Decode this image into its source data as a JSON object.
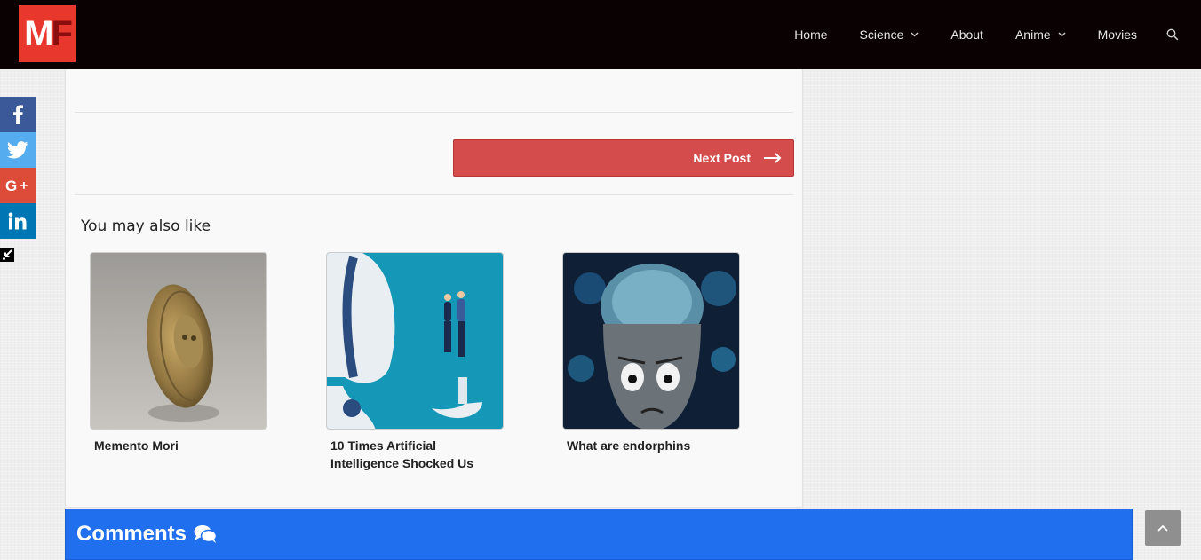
{
  "header": {
    "logo_text_m": "M",
    "logo_text_f": "F",
    "nav": [
      {
        "label": "Home",
        "dropdown": false
      },
      {
        "label": "Science",
        "dropdown": true
      },
      {
        "label": "About",
        "dropdown": false
      },
      {
        "label": "Anime",
        "dropdown": true
      },
      {
        "label": "Movies",
        "dropdown": false
      }
    ]
  },
  "post_nav": {
    "next_label": "Next Post"
  },
  "related": {
    "heading": "You may also like",
    "items": [
      {
        "title": "Memento Mori",
        "image": "coin-photo"
      },
      {
        "title": "10 Times Artificial Intelligence Shocked Us",
        "image": "robot-illustration"
      },
      {
        "title": "What are endorphins",
        "image": "anime-brain"
      }
    ]
  },
  "social": [
    "facebook-icon",
    "twitter-icon",
    "google-plus-icon",
    "linkedin-icon"
  ],
  "comments": {
    "label": "Comments"
  },
  "colors": {
    "topbar": "#0a0102",
    "logo": "#e8372c",
    "next_button": "#d54c4c",
    "comments_bar": "#1f6fef",
    "facebook": "#3b5998",
    "twitter": "#55acee",
    "google_plus": "#dd4b39",
    "linkedin": "#0077b5"
  }
}
